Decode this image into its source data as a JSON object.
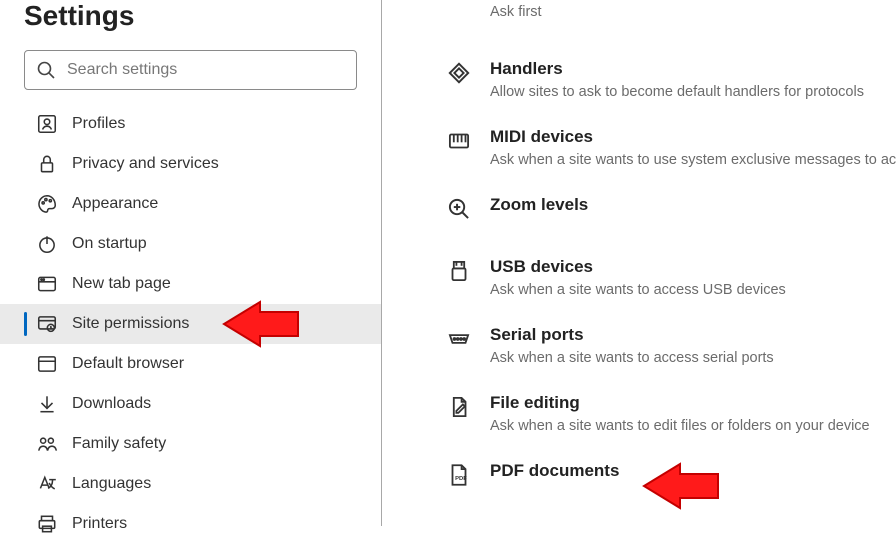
{
  "page_title": "Settings",
  "search": {
    "placeholder": "Search settings"
  },
  "sidebar": {
    "items": [
      {
        "label": "Profiles"
      },
      {
        "label": "Privacy and services"
      },
      {
        "label": "Appearance"
      },
      {
        "label": "On startup"
      },
      {
        "label": "New tab page"
      },
      {
        "label": "Site permissions"
      },
      {
        "label": "Default browser"
      },
      {
        "label": "Downloads"
      },
      {
        "label": "Family safety"
      },
      {
        "label": "Languages"
      },
      {
        "label": "Printers"
      }
    ]
  },
  "permissions": [
    {
      "title": "",
      "desc": "Ask first"
    },
    {
      "title": "Handlers",
      "desc": "Allow sites to ask to become default handlers for protocols"
    },
    {
      "title": "MIDI devices",
      "desc": "Ask when a site wants to use system exclusive messages to ac"
    },
    {
      "title": "Zoom levels",
      "desc": ""
    },
    {
      "title": "USB devices",
      "desc": "Ask when a site wants to access USB devices"
    },
    {
      "title": "Serial ports",
      "desc": "Ask when a site wants to access serial ports"
    },
    {
      "title": "File editing",
      "desc": "Ask when a site wants to edit files or folders on your device"
    },
    {
      "title": "PDF documents",
      "desc": ""
    }
  ]
}
